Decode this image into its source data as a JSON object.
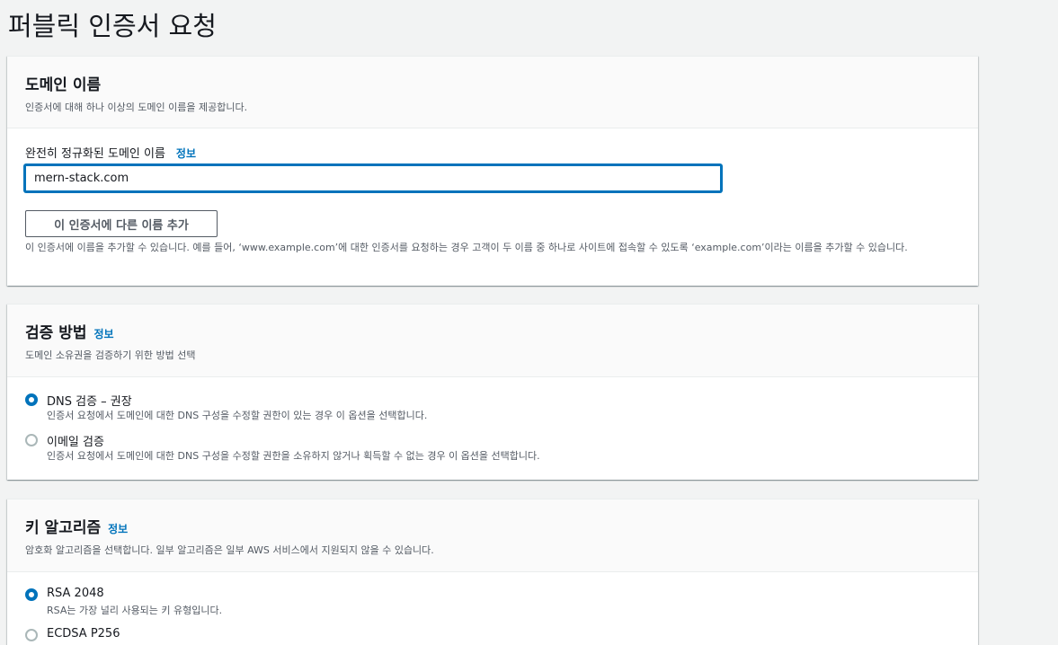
{
  "page": {
    "title": "퍼블릭 인증서 요청"
  },
  "domain_section": {
    "title": "도메인 이름",
    "description": "인증서에 대해 하나 이상의 도메인 이름을 제공합니다.",
    "field_label": "완전히 정규화된 도메인 이름",
    "info_label": "정보",
    "input_value": "mern-stack.com",
    "add_button_label": "이 인증서에 다른 이름 추가",
    "help_text": "이 인증서에 이름을 추가할 수 있습니다. 예를 들어, ‘www.example.com’에 대한 인증서를 요청하는 경우 고객이 두 이름 중 하나로 사이트에 접속할 수 있도록 ‘example.com’이라는 이름을 추가할 수 있습니다."
  },
  "validation_section": {
    "title": "검증 방법",
    "info_label": "정보",
    "description": "도메인 소유권을 검증하기 위한 방법 선택",
    "options": [
      {
        "label": "DNS 검증 – 권장",
        "description": "인증서 요청에서 도메인에 대한 DNS 구성을 수정할 권한이 있는 경우 이 옵션을 선택합니다.",
        "selected": true
      },
      {
        "label": "이메일 검증",
        "description": "인증서 요청에서 도메인에 대한 DNS 구성을 수정할 권한을 소유하지 않거나 획득할 수 없는 경우 이 옵션을 선택합니다.",
        "selected": false
      }
    ]
  },
  "algorithm_section": {
    "title": "키 알고리즘",
    "info_label": "정보",
    "description": "암호화 알고리즘을 선택합니다. 일부 알고리즘은 일부 AWS 서비스에서 지원되지 않을 수 있습니다.",
    "options": [
      {
        "label": "RSA 2048",
        "description": "RSA는 가장 널리 사용되는 키 유형입니다.",
        "selected": true
      },
      {
        "label": "ECDSA P256",
        "selected": false
      }
    ]
  },
  "colors": {
    "accent": "#0073bb",
    "background": "#f2f3f3",
    "text": "#16191f",
    "muted": "#545b64"
  }
}
